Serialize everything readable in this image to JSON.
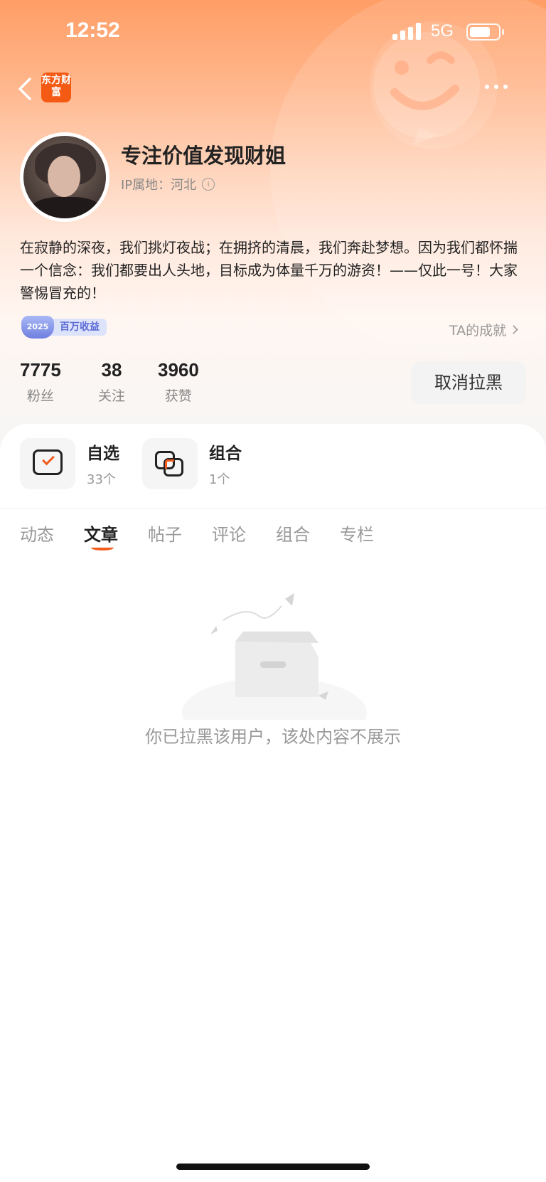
{
  "status_bar": {
    "time": "12:52",
    "network": "5G"
  },
  "nav": {
    "logo_text": "东方财富"
  },
  "profile": {
    "name": "专注价值发现财姐",
    "ip_location": "IP属地：河北",
    "bio": "在寂静的深夜，我们挑灯夜战；在拥挤的清晨，我们奔赴梦想。因为我们都怀揣一个信念：我们都要出人头地，目标成为体量千万的游资！——仅此一号！大家警惕冒充的！",
    "badge": {
      "year": "2025",
      "label": "百万收益"
    },
    "achievement_link": "TA的成就"
  },
  "stats": [
    {
      "value": "7775",
      "label": "粉丝"
    },
    {
      "value": "38",
      "label": "关注"
    },
    {
      "value": "3960",
      "label": "获赞"
    }
  ],
  "unblock_button": "取消拉黑",
  "features": [
    {
      "title": "自选",
      "count": "33个"
    },
    {
      "title": "组合",
      "count": "1个"
    }
  ],
  "tabs": [
    "动态",
    "文章",
    "帖子",
    "评论",
    "组合",
    "专栏"
  ],
  "active_tab": "文章",
  "empty_message": "你已拉黑该用户，该处内容不展示",
  "colors": {
    "accent": "#f25b1b",
    "brand": "#f45a13",
    "header_gradient_top": "#ff9e66"
  }
}
